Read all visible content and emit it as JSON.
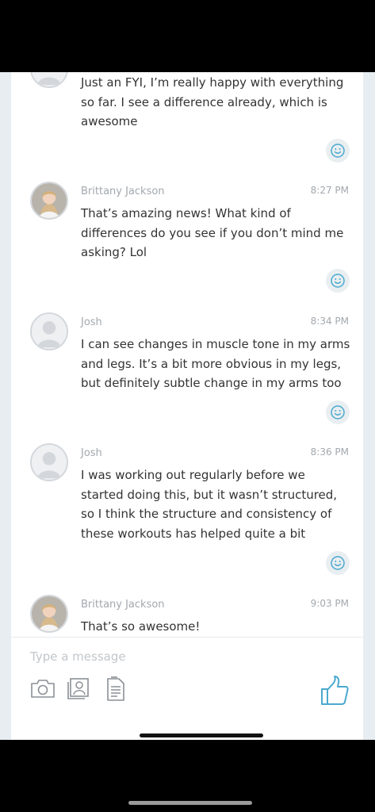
{
  "messages": [
    {
      "sender": "",
      "time": "",
      "lines": [
        "Just an FYI, I’m really happy with everything",
        "so far. I see a difference already, which is",
        "awesome"
      ],
      "avatar": "person-placeholder-icon"
    },
    {
      "sender": "Brittany Jackson",
      "time": "8:27 PM",
      "lines": [
        "That’s amazing news! What kind of",
        "differences do you see if you don’t mind me",
        "asking? Lol"
      ],
      "avatar": "photo"
    },
    {
      "sender": "Josh",
      "time": "8:34 PM",
      "lines": [
        "I can see changes in muscle tone in my arms",
        "and legs. It’s a bit more obvious in my legs,",
        "but definitely subtle change in my arms too"
      ],
      "avatar": "person-placeholder-icon"
    },
    {
      "sender": "Josh",
      "time": "8:36 PM",
      "lines": [
        "I was working out regularly before we",
        "started doing this, but it wasn’t structured,",
        "so I think the structure and consistency of",
        "these workouts has helped quite a bit"
      ],
      "avatar": "person-placeholder-icon"
    },
    {
      "sender": "Brittany Jackson",
      "time": "9:03 PM",
      "lines": [
        "That’s so awesome!"
      ],
      "avatar": "photo"
    }
  ],
  "composer": {
    "placeholder": "Type a message",
    "icons": [
      "camera-icon",
      "contact-card-icon",
      "document-icon",
      "thumbs-up-icon"
    ]
  },
  "colors": {
    "accent": "#4aa9cf",
    "icon_gray": "#8b9096",
    "meta_text": "#a3a8ad",
    "body_text": "#333333"
  }
}
